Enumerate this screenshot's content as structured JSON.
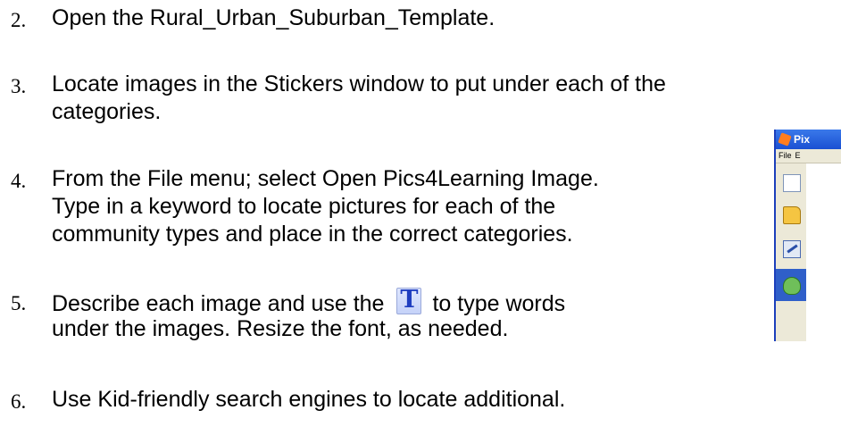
{
  "steps": [
    {
      "number": "2.",
      "lines": [
        "Open the Rural_Urban_Suburban_Template."
      ]
    },
    {
      "number": "3.",
      "lines": [
        "Locate images in the Stickers window to put under each of the",
        "categories."
      ]
    },
    {
      "number": "4.",
      "lines": [
        "From the File menu; select Open Pics4Learning Image.",
        "Type in a keyword to locate pictures for each of the",
        "community types and place in the correct categories."
      ]
    },
    {
      "number": "5.",
      "line1_before": "Describe each image and use the",
      "text_tool_glyph": "T",
      "line1_after": "to type words",
      "line2": "under the images.  Resize the font, as needed."
    },
    {
      "number": "6.",
      "lines": [
        "Use Kid-friendly search engines to locate additional."
      ]
    }
  ],
  "pixie_window": {
    "title": "Pix",
    "menu": [
      "File",
      "E"
    ],
    "tool_icons": [
      "new-document-icon",
      "open-folder-icon",
      "edit-picture-icon",
      "stickers-icon"
    ],
    "colors": {
      "title_bar": "#1a50d2",
      "selected_tool": "#2f5fc9",
      "toolbar_bg": "#ece9d8"
    }
  },
  "icons": {
    "text_tool": "text-tool-icon"
  }
}
